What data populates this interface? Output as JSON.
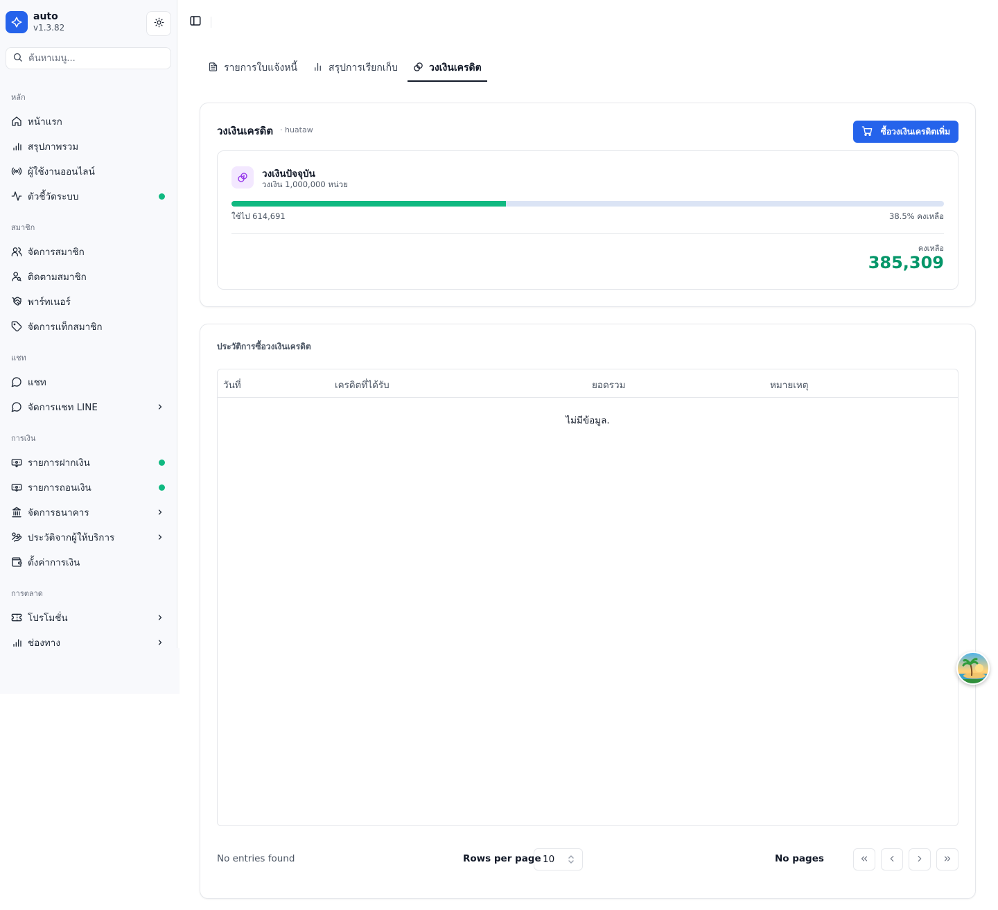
{
  "app": {
    "name": "auto",
    "version": "v1.3.82"
  },
  "search": {
    "placeholder": "ค้นหาเมนู..."
  },
  "sidebar": {
    "sections": [
      {
        "label": "หลัก",
        "items": [
          {
            "label": "หน้าแรก",
            "icon": "home-icon"
          },
          {
            "label": "สรุปภาพรวม",
            "icon": "bar-chart-icon"
          },
          {
            "label": "ผู้ใช้งานออนไลน์",
            "icon": "radio-icon"
          },
          {
            "label": "ตัวชี้วัดระบบ",
            "icon": "activity-icon",
            "status": "online"
          }
        ]
      },
      {
        "label": "สมาชิก",
        "items": [
          {
            "label": "จัดการสมาชิก",
            "icon": "users-icon"
          },
          {
            "label": "ติดตามสมาชิก",
            "icon": "user-search-icon"
          },
          {
            "label": "พาร์ทเนอร์",
            "icon": "handshake-icon"
          },
          {
            "label": "จัดการแท็กสมาชิก",
            "icon": "tag-icon"
          }
        ]
      },
      {
        "label": "แชท",
        "items": [
          {
            "label": "แชท",
            "icon": "message-circle-icon"
          },
          {
            "label": "จัดการแชท LINE",
            "icon": "message-circle-icon",
            "expandable": true
          }
        ]
      },
      {
        "label": "การเงิน",
        "items": [
          {
            "label": "รายการฝากเงิน",
            "icon": "deposit-icon",
            "status": "online"
          },
          {
            "label": "รายการถอนเงิน",
            "icon": "withdraw-icon",
            "status": "online"
          },
          {
            "label": "จัดการธนาคาร",
            "icon": "bank-icon",
            "expandable": true
          },
          {
            "label": "ประวัติจากผู้ให้บริการ",
            "icon": "hand-coins-icon",
            "expandable": true
          },
          {
            "label": "ตั้งค่าการเงิน",
            "icon": "wallet-icon"
          }
        ]
      },
      {
        "label": "การตลาด",
        "items": [
          {
            "label": "โปรโมชั่น",
            "icon": "ticket-icon",
            "expandable": true
          },
          {
            "label": "ช่องทาง",
            "icon": "bar-chart-icon",
            "expandable": true
          }
        ]
      }
    ]
  },
  "tabs": [
    {
      "label": "รายการใบแจ้งหนี้",
      "icon": "file-text-icon",
      "active": false
    },
    {
      "label": "สรุปการเรียกเก็บ",
      "icon": "bar-chart-icon",
      "active": false
    },
    {
      "label": "วงเงินเครดิต",
      "icon": "coins-icon",
      "active": true
    }
  ],
  "credit_card": {
    "title": "วงเงินเครดิต",
    "subtitle": "· huataw",
    "buy_button": "ซื้อวงเงินเครดิตเพิ่ม",
    "current_title": "วงเงินปัจจุบัน",
    "current_limit": "วงเงิน 1,000,000 หน่วย",
    "used_fraction": 0.385,
    "used_label": "ใช้ไป 614,691",
    "remain_pct_label": "38.5% คงเหลือ",
    "remain_label": "คงเหลือ",
    "remain_value": "385,309",
    "colors": {
      "progress_fill": "#10b981",
      "progress_track": "#dbe4f5",
      "remain_value": "#059669",
      "accent": "#2563eb"
    }
  },
  "history": {
    "title": "ประวัติการซื้อวงเงินเครดิต",
    "columns": [
      "วันที่",
      "เครดิตที่ได้รับ",
      "ยอดรวม",
      "หมายเหตุ"
    ],
    "rows": [],
    "empty_text": "ไม่มีข้อมูล.",
    "footer": {
      "entries_text": "No entries found",
      "rows_per_page_label": "Rows per page",
      "rows_per_page_value": "10",
      "pages_text": "No pages"
    }
  }
}
